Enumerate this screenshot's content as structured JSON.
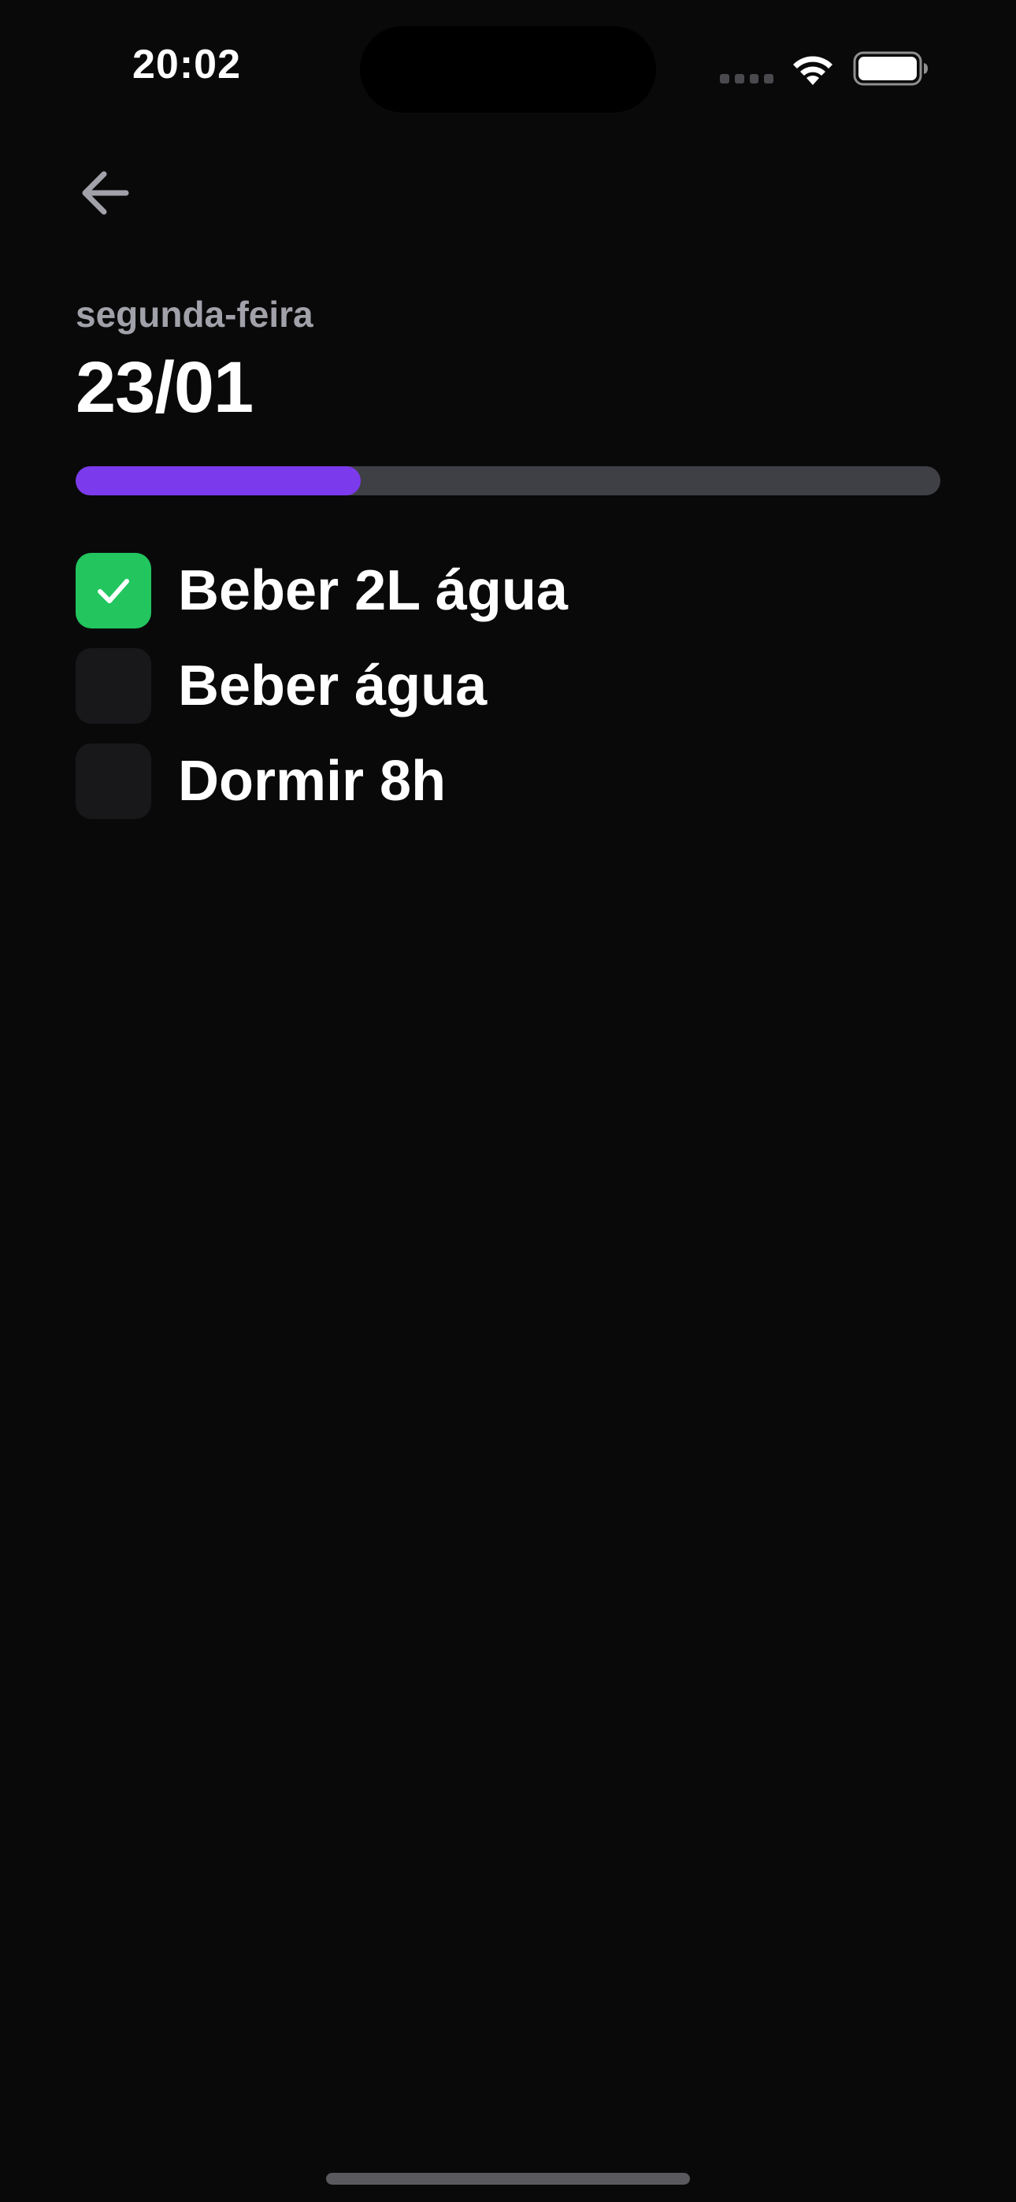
{
  "status_bar": {
    "time": "20:02",
    "signal_icon": "cellular-signal-icon",
    "wifi_icon": "wifi-icon",
    "battery_icon": "battery-full-icon"
  },
  "header": {
    "back_icon": "arrow-left-icon",
    "weekday": "segunda-feira",
    "date": "23/01"
  },
  "progress": {
    "completed_fraction": 0.33,
    "fill_color": "#7c3aed",
    "track_color": "#3f3f46"
  },
  "habits": [
    {
      "label": "Beber 2L água",
      "checked": true
    },
    {
      "label": "Beber água",
      "checked": false
    },
    {
      "label": "Dormir 8h",
      "checked": false
    }
  ],
  "colors": {
    "background": "#09090a",
    "checked": "#22c55e",
    "unchecked": "#18181b",
    "muted_text": "#a1a1aa"
  }
}
